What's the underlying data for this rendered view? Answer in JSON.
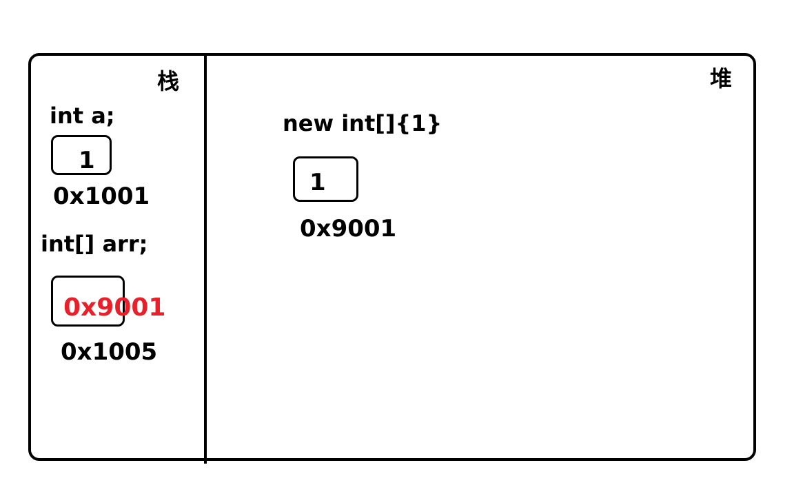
{
  "stack": {
    "title": "栈",
    "var_a": {
      "declaration": "int a;",
      "value": "1",
      "address": "0x1001"
    },
    "var_arr": {
      "declaration": "int[] arr;",
      "value": "0x9001",
      "address": "0x1005"
    }
  },
  "heap": {
    "title": "堆",
    "object": {
      "expression": "new int[]{1}",
      "value": "1",
      "address": "0x9001"
    }
  },
  "colors": {
    "border": "#000000",
    "reference_value": "#e8202a"
  }
}
